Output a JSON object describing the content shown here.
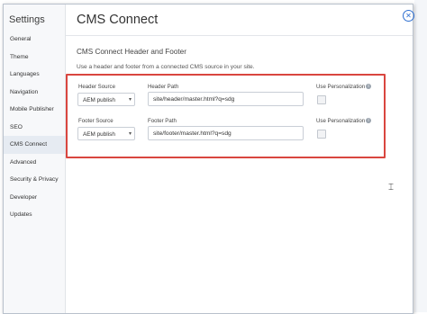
{
  "modal": {
    "sidebar": {
      "title": "Settings",
      "items": [
        {
          "label": "General"
        },
        {
          "label": "Theme"
        },
        {
          "label": "Languages"
        },
        {
          "label": "Navigation"
        },
        {
          "label": "Mobile Publisher"
        },
        {
          "label": "SEO"
        },
        {
          "label": "CMS Connect",
          "active": true
        },
        {
          "label": "Advanced"
        },
        {
          "label": "Security & Privacy"
        },
        {
          "label": "Developer"
        },
        {
          "label": "Updates"
        }
      ]
    },
    "page_title": "CMS Connect",
    "close_icon": "close-icon",
    "section_title": "CMS Connect Header and Footer",
    "description": "Use a header and footer from a connected CMS source in your site.",
    "header": {
      "source_label": "Header Source",
      "source_value": "AEM publish",
      "path_label": "Header Path",
      "path_value": "site/header/master.html?q=sdg",
      "personalization_label": "Use Personalization",
      "personalization_checked": false
    },
    "footer": {
      "source_label": "Footer Source",
      "source_value": "AEM publish",
      "path_label": "Footer Path",
      "path_value": "site/footer/master.html?q=sdg",
      "personalization_label": "Use Personalization",
      "personalization_checked": false
    },
    "highlight_color": "#d9463f",
    "accent_color": "#2e6fd0"
  }
}
